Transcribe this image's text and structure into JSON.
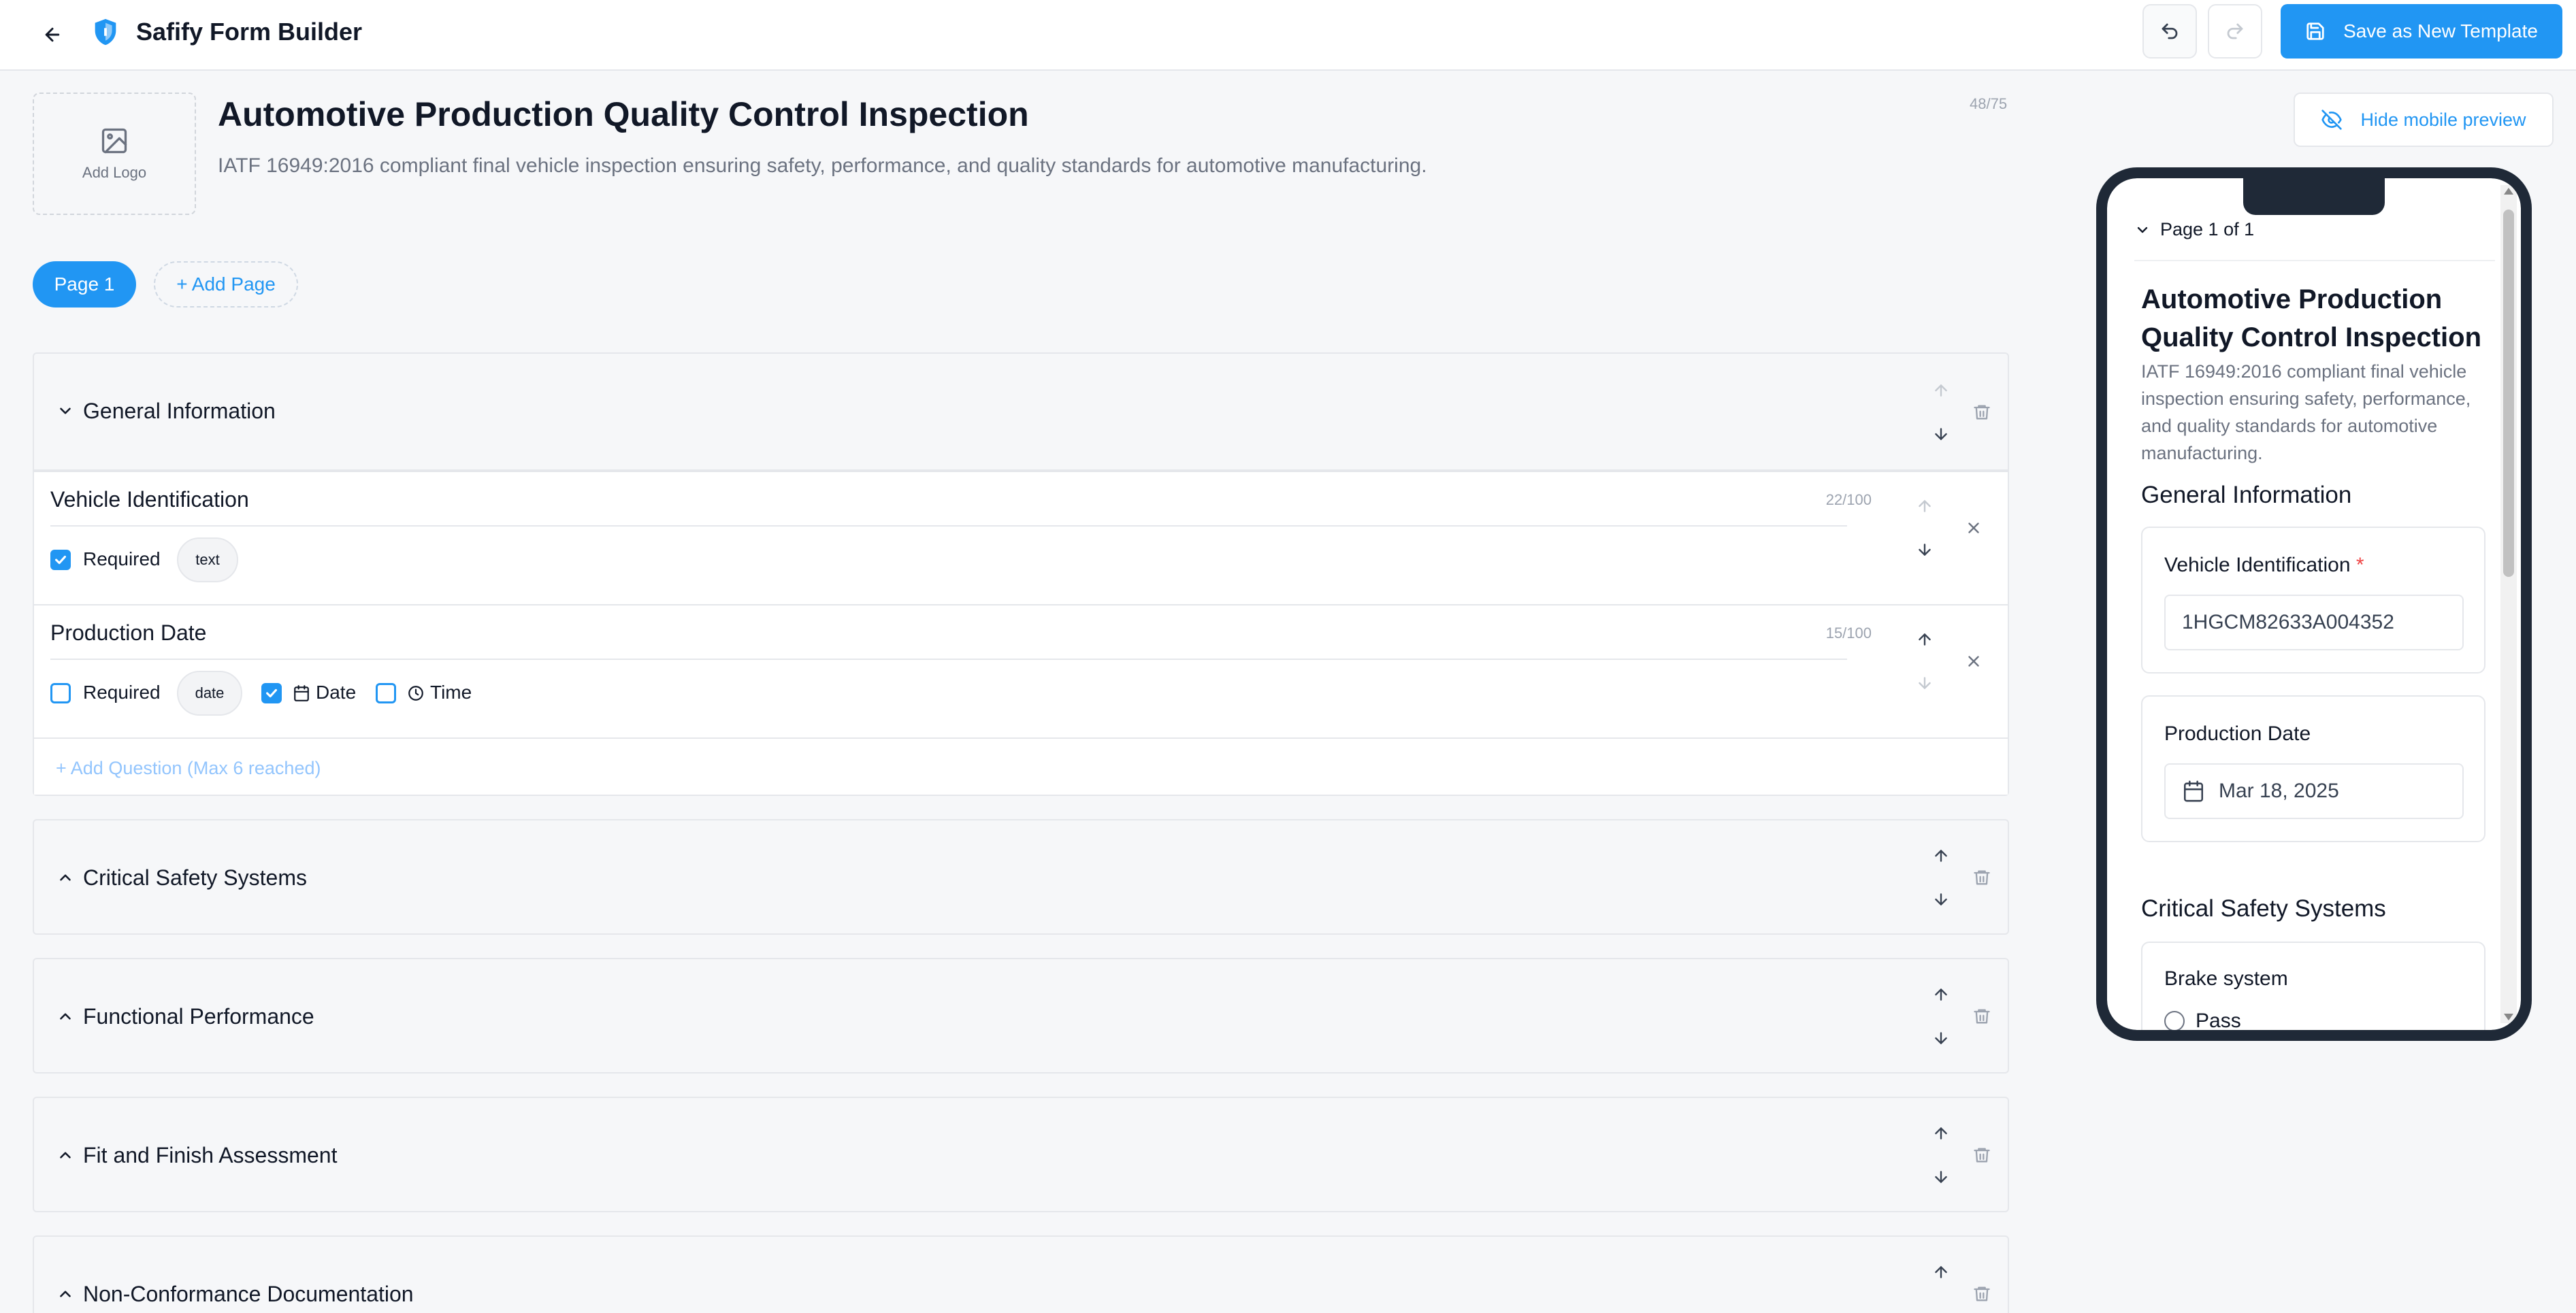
{
  "header": {
    "app_title": "Safify Form Builder",
    "save_label": "Save as New Template"
  },
  "form": {
    "logo_label": "Add Logo",
    "title": "Automotive Production Quality Control Inspection",
    "description": "IATF 16949:2016 compliant final vehicle inspection ensuring safety, performance, and quality standards for automotive manufacturing.",
    "title_count": "48/75"
  },
  "pages": {
    "active": "Page 1",
    "add_label": "+ Add Page"
  },
  "sections": [
    {
      "title": "General Information",
      "expanded": true,
      "questions": [
        {
          "label": "Vehicle Identification",
          "count": "22/100",
          "required_label": "Required",
          "required": true,
          "type": "text"
        },
        {
          "label": "Production Date",
          "count": "15/100",
          "required_label": "Required",
          "required": false,
          "type": "date",
          "date_label": "Date",
          "date_checked": true,
          "time_label": "Time",
          "time_checked": false
        }
      ],
      "add_question": "+ Add Question (Max 6 reached)"
    },
    {
      "title": "Critical Safety Systems",
      "expanded": false
    },
    {
      "title": "Functional Performance",
      "expanded": false
    },
    {
      "title": "Fit and Finish Assessment",
      "expanded": false
    },
    {
      "title": "Non-Conformance Documentation",
      "expanded": false
    }
  ],
  "preview": {
    "toggle_label": "Hide mobile preview",
    "page_label": "Page 1 of 1",
    "title": "Automotive Production Quality Control Inspection",
    "description": "IATF 16949:2016 compliant final vehicle inspection ensuring safety, performance, and quality standards for automotive manufacturing.",
    "section1": "General Information",
    "q1_label": "Vehicle Identification",
    "q1_required_mark": "*",
    "q1_value": "1HGCM82633A004352",
    "q2_label": "Production Date",
    "q2_value": "Mar 18, 2025",
    "section2": "Critical Safety Systems",
    "q3_label": "Brake system",
    "q3_option": "Pass"
  },
  "colors": {
    "accent": "#2196f3",
    "background": "#f6f7f9",
    "border": "#e5e7eb",
    "muted_text": "#6b7280",
    "required": "#ef4444"
  }
}
